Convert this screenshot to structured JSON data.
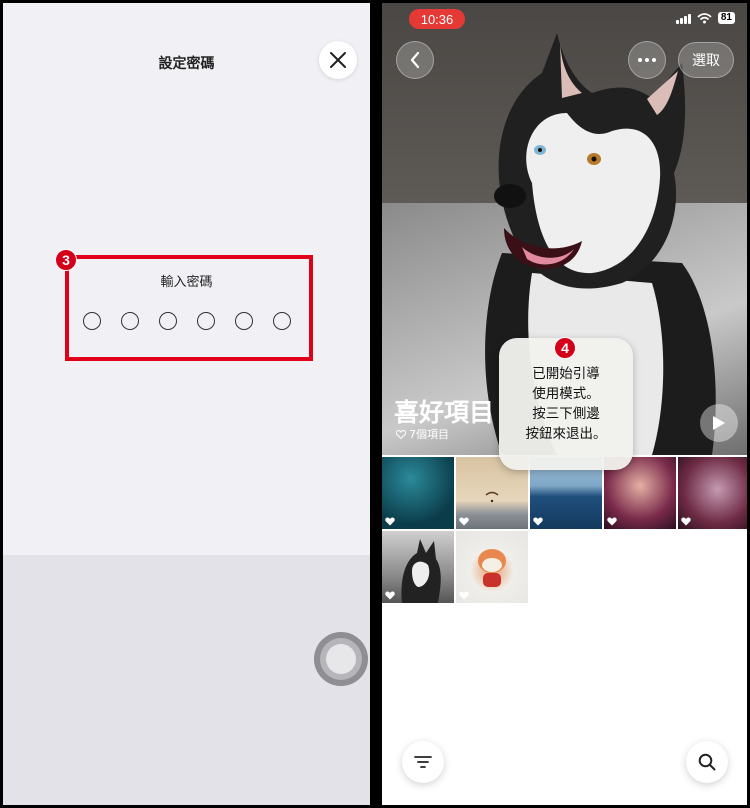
{
  "left_screen": {
    "title": "設定密碼",
    "prompt": "輸入密碼",
    "passcode_length": 6,
    "step_number": "3",
    "highlight_color": "#e00018"
  },
  "right_screen": {
    "status": {
      "time": "10:36",
      "battery": "81"
    },
    "select_label": "選取",
    "album_title": "喜好項目",
    "album_count": "7個項目",
    "step_number": "4",
    "tooltip_lines": [
      "已開始引導",
      "使用模式。",
      "按三下側邊",
      "按鈕來退出。"
    ],
    "tiles": [
      {
        "subject": "underwater",
        "favorite": true
      },
      {
        "subject": "paraglider",
        "favorite": true
      },
      {
        "subject": "ocean",
        "favorite": true
      },
      {
        "subject": "concert",
        "favorite": true
      },
      {
        "subject": "performer",
        "favorite": true
      },
      {
        "subject": "husky",
        "favorite": true
      },
      {
        "subject": "cat-figurine",
        "favorite": true
      }
    ]
  },
  "colors": {
    "accent_red": "#e53935",
    "badge_red": "#d4001a"
  }
}
